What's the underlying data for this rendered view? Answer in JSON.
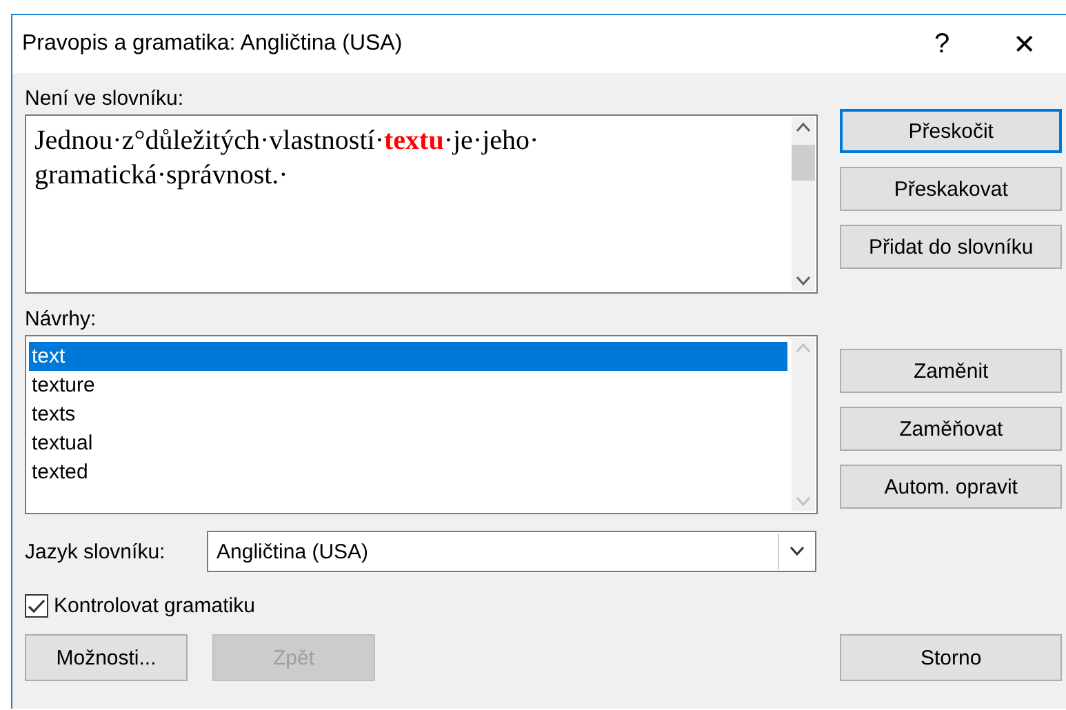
{
  "window": {
    "title": "Pravopis a gramatika: Angličtina (USA)",
    "controls": [
      "?",
      "✕"
    ]
  },
  "not_in_dictionary": {
    "label": "Není ve slovníku:",
    "lines": [
      [
        {
          "text": "Jednou·z°důležitých·vlastností·",
          "error": false
        },
        {
          "text": "textu",
          "error": true
        },
        {
          "text": "·je·jeho·",
          "error": false
        }
      ],
      [
        {
          "text": "gramatická·správnost.·",
          "error": false
        }
      ]
    ]
  },
  "top_buttons": [
    {
      "label": "Přeskočit",
      "default": true,
      "disabled": false
    },
    {
      "label": "Přeskakovat",
      "default": false,
      "disabled": false
    },
    {
      "label": "Přidat do slovníku",
      "default": false,
      "disabled": false
    }
  ],
  "suggestions": {
    "label": "Návrhy:",
    "items": [
      {
        "text": "text",
        "selected": true
      },
      {
        "text": "texture",
        "selected": false
      },
      {
        "text": "texts",
        "selected": false
      },
      {
        "text": "textual",
        "selected": false
      },
      {
        "text": "texted",
        "selected": false
      }
    ]
  },
  "replace_buttons": [
    {
      "label": "Zaměnit",
      "default": false,
      "disabled": false
    },
    {
      "label": "Zaměňovat",
      "default": false,
      "disabled": false
    },
    {
      "label": "Autom. opravit",
      "default": false,
      "disabled": false
    }
  ],
  "dictionary_language": {
    "label": "Jazyk slovníku:",
    "value": "Angličtina (USA)"
  },
  "check_grammar": {
    "label": "Kontrolovat gramatiku",
    "checked": true
  },
  "bottom_buttons": [
    {
      "label": "Možnosti...",
      "default": false,
      "disabled": false
    },
    {
      "label": "Zpět",
      "default": false,
      "disabled": true
    }
  ],
  "cancel_button": {
    "label": "Storno",
    "default": false,
    "disabled": false
  }
}
